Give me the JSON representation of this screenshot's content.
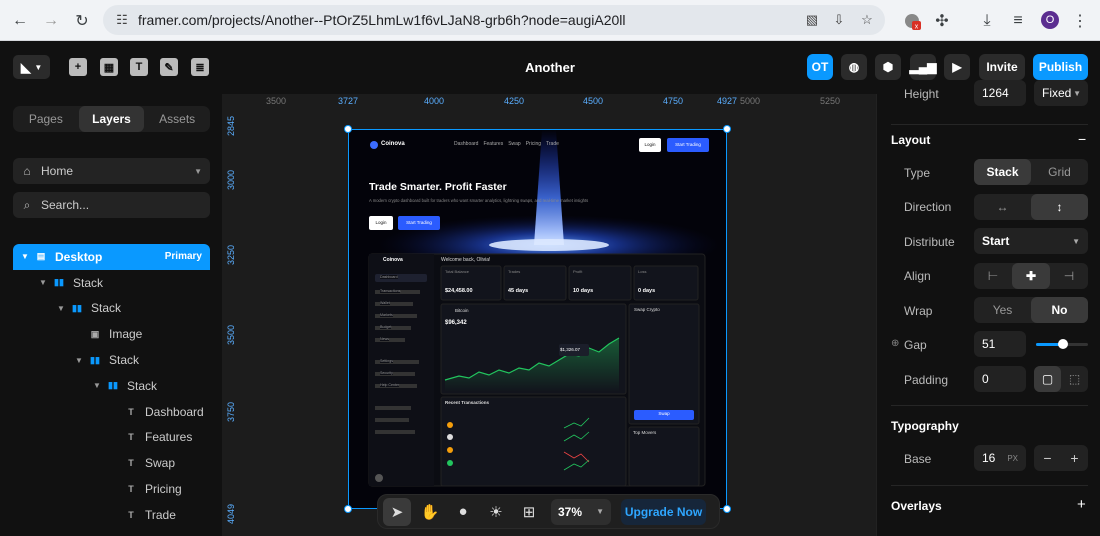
{
  "browser": {
    "url": "framer.com/projects/Another--PtOrZ5LhmLw1f6vLJaN8-grb6h?node=augiA20ll",
    "profile_initial": "O"
  },
  "topbar": {
    "project_title": "Another",
    "avatar_initials": "OT",
    "invite_label": "Invite",
    "publish_label": "Publish"
  },
  "left_panel": {
    "tabs": [
      "Pages",
      "Layers",
      "Assets"
    ],
    "active_tab": "Layers",
    "page_select": "Home",
    "search_placeholder": "Search...",
    "layers": [
      {
        "name": "Desktop",
        "type": "frame",
        "tag": "Primary",
        "depth": 0
      },
      {
        "name": "Stack",
        "type": "stack",
        "depth": 1
      },
      {
        "name": "Stack",
        "type": "stack",
        "depth": 2
      },
      {
        "name": "Image",
        "type": "image",
        "depth": 3
      },
      {
        "name": "Stack",
        "type": "stack",
        "depth": 3
      },
      {
        "name": "Stack",
        "type": "stack",
        "depth": 4
      },
      {
        "name": "Dashboard",
        "type": "text",
        "depth": 5
      },
      {
        "name": "Features",
        "type": "text",
        "depth": 5
      },
      {
        "name": "Swap",
        "type": "text",
        "depth": 5
      },
      {
        "name": "Pricing",
        "type": "text",
        "depth": 5
      },
      {
        "name": "Trade",
        "type": "text",
        "depth": 5
      }
    ]
  },
  "canvas": {
    "ruler_ticks": [
      "3500",
      "3727",
      "4000",
      "4250",
      "4500",
      "4750",
      "4927",
      "5000",
      "5250"
    ],
    "vruler_ticks": [
      "2845",
      "3000",
      "3250",
      "3500",
      "3750",
      "4049"
    ],
    "zoom": "37%",
    "upgrade_label": "Upgrade Now",
    "preview": {
      "brand": "Coinova",
      "nav": [
        "Dashboard",
        "Features",
        "Swap",
        "Pricing",
        "Trade"
      ],
      "login": "Login",
      "start_trading": "Start Trading",
      "hero_title": "Trade Smarter. Profit Faster",
      "hero_sub": "A modern crypto dashboard built for traders who want smarter analytics, lightning swaps, and real-time market insights",
      "dash_welcome": "Welcome back, Olivia!",
      "stats": [
        {
          "label": "Total Balance",
          "value": "$24,458.00"
        },
        {
          "label": "Trades",
          "value": "45 days"
        },
        {
          "label": "Profit",
          "value": "10 days"
        },
        {
          "label": "Loss",
          "value": "0 days"
        }
      ],
      "coin": "Bitcoin",
      "coin_value": "$96,342",
      "tooltip": "$1,326.07",
      "swap_title": "Swap Crypto",
      "swap_btn": "Swap",
      "recent_title": "Recent Transactions",
      "top_movers": "Top Movers",
      "sidebar_items": [
        "Dashboard",
        "Transactions",
        "Wallet",
        "Markets",
        "Budget",
        "News",
        "Settings",
        "Security",
        "Help Center"
      ]
    }
  },
  "right_panel": {
    "height_value": "1264",
    "height_mode": "Fixed",
    "height_label": "Height",
    "layout_title": "Layout",
    "type_label": "Type",
    "type_options": [
      "Stack",
      "Grid"
    ],
    "direction_label": "Direction",
    "distribute_label": "Distribute",
    "distribute_value": "Start",
    "align_label": "Align",
    "wrap_label": "Wrap",
    "wrap_options": [
      "Yes",
      "No"
    ],
    "gap_label": "Gap",
    "gap_value": "51",
    "padding_label": "Padding",
    "padding_value": "0",
    "typography_title": "Typography",
    "base_label": "Base",
    "base_value": "16",
    "base_unit": "PX",
    "overlays_title": "Overlays"
  }
}
